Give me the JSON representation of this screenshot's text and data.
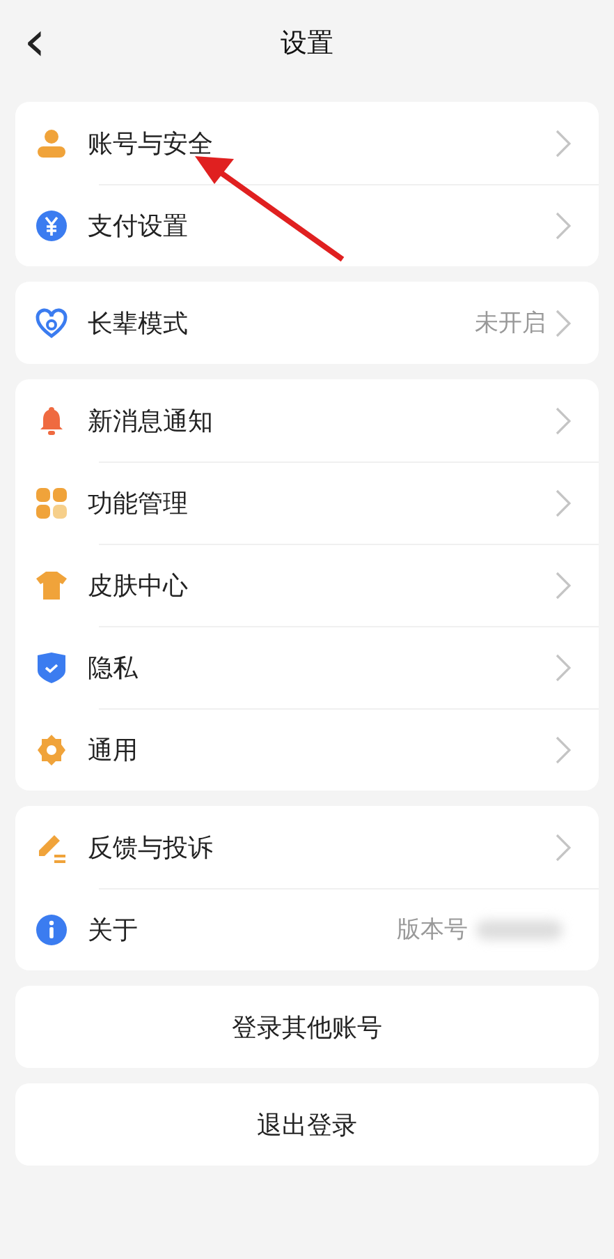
{
  "header": {
    "back": "‹",
    "title": "设置"
  },
  "groups": [
    [
      {
        "kind": "person",
        "label": "账号与安全",
        "chevron": true
      },
      {
        "kind": "yuan",
        "label": "支付设置",
        "chevron": true
      }
    ],
    [
      {
        "kind": "heart",
        "label": "长辈模式",
        "value": "未开启",
        "chevron": true
      }
    ],
    [
      {
        "kind": "bell",
        "label": "新消息通知",
        "chevron": true
      },
      {
        "kind": "grid",
        "label": "功能管理",
        "chevron": true
      },
      {
        "kind": "shirt",
        "label": "皮肤中心",
        "chevron": true
      },
      {
        "kind": "shield",
        "label": "隐私",
        "chevron": true
      },
      {
        "kind": "gear",
        "label": "通用",
        "chevron": true
      }
    ],
    [
      {
        "kind": "pencil",
        "label": "反馈与投诉",
        "chevron": true
      },
      {
        "kind": "info",
        "label": "关于",
        "value": "版本号",
        "blurred": true,
        "chevron": false
      }
    ]
  ],
  "buttons": [
    "登录其他账号",
    "退出登录"
  ]
}
